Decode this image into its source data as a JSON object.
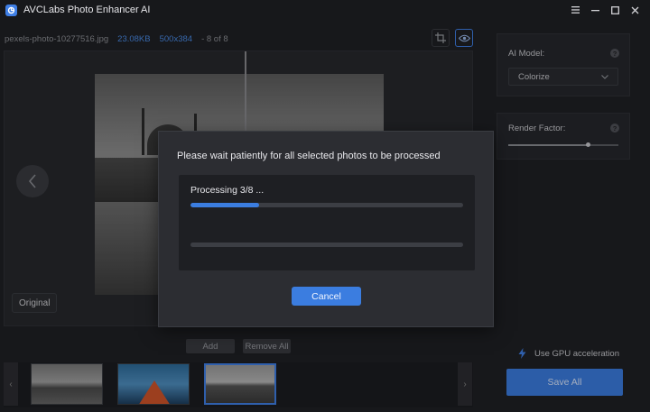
{
  "app": {
    "title": "AVCLabs Photo Enhancer AI",
    "icons": [
      "app-logo-icon",
      "menu-icon",
      "minimize-icon",
      "maximize-icon",
      "close-icon"
    ]
  },
  "image_info": {
    "filename": "pexels-photo-10277516.jpg",
    "size": "23.08KB",
    "dimensions": "500x384",
    "counter": "- 8 of 8"
  },
  "preview": {
    "original_label": "Original"
  },
  "strip": {
    "add_label": "Add",
    "remove_all_label": "Remove All"
  },
  "ai_model": {
    "label": "AI Model:",
    "selected": "Colorize"
  },
  "render_factor": {
    "label": "Render Factor:",
    "level": 0.72
  },
  "gpu": {
    "label": "Use GPU acceleration"
  },
  "save_all_label": "Save All",
  "dialog": {
    "title": "Please wait patiently for all selected photos to be processed",
    "progress_text": "Processing 3/8 ...",
    "progress_current": 0.25,
    "progress_overall": 0,
    "cancel_label": "Cancel"
  },
  "colors": {
    "accent": "#3b7de0",
    "background": "#1f2024",
    "panel": "#26272c"
  }
}
